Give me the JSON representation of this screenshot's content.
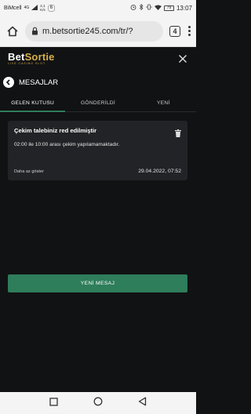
{
  "status_bar": {
    "carrier": "BiMcell",
    "network": "4G",
    "speed_value": "2,1",
    "speed_unit": "K/s",
    "notification_count": "6",
    "battery": "79",
    "time": "13:07"
  },
  "browser": {
    "url": "m.betsortie245.com/tr/?",
    "tab_count": "4"
  },
  "site": {
    "logo_bet": "Bet",
    "logo_sortie": "Sortie",
    "logo_tagline": "LIVE CASINO SLOT"
  },
  "page": {
    "title": "MESAJLAR"
  },
  "tabs": [
    {
      "label": "GELEN KUTUSU"
    },
    {
      "label": "GÖNDERİLDİ"
    },
    {
      "label": "YENİ"
    }
  ],
  "message": {
    "title": "Çekim talebiniz red edilmiştir",
    "body": "02:00 ile 10:00 arası çekim yapılamamaktadır.",
    "toggle_label": "Daha az göster",
    "date": "29.04.2022, 07:52"
  },
  "actions": {
    "new_message_label": "YENİ MESAJ"
  },
  "colors": {
    "background": "#111214",
    "card": "#222326",
    "accent_green": "#2e7d5b",
    "brand_gold": "#d8b04a"
  }
}
